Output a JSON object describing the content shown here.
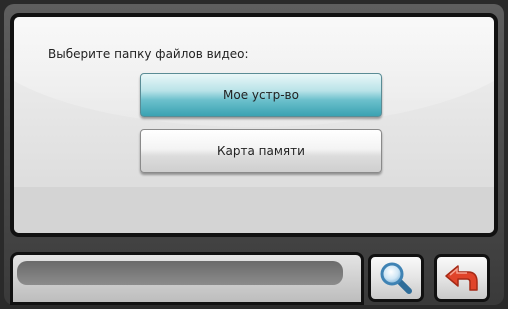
{
  "dialog": {
    "prompt": "Выберите папку файлов видео:",
    "options": [
      {
        "label": "Мое устр-во",
        "selected": true
      },
      {
        "label": "Карта памяти",
        "selected": false
      }
    ]
  },
  "toolbar": {
    "search_icon": "magnifier-icon",
    "back_icon": "back-arrow-icon"
  },
  "colors": {
    "selected_accent": "#3aa2b2",
    "back_arrow": "#e0442a"
  }
}
